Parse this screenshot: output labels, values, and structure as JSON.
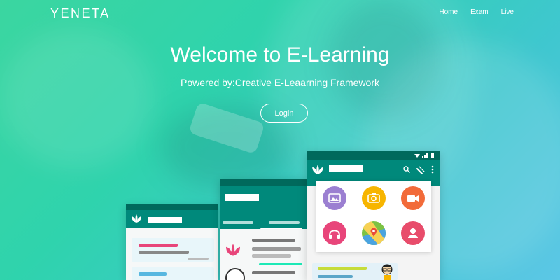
{
  "brand": "YENETA",
  "nav": {
    "home": "Home",
    "exam": "Exam",
    "live": "Live"
  },
  "hero": {
    "title": "Welcome to E-Learning",
    "subtitle": "Powered by:Creative E-Leaarning Framework",
    "login_label": "Login"
  },
  "icons": {
    "lotus": "lotus-icon",
    "search": "search-icon",
    "attach": "paperclip-icon",
    "more": "more-vert-icon",
    "gallery": "gallery-icon",
    "camera": "camera-icon",
    "video": "video-icon",
    "headphones": "headphones-icon",
    "map": "map-icon",
    "contact": "contact-icon"
  },
  "colors": {
    "gradient_start": "#3bd6a0",
    "gradient_end": "#5cc7e6",
    "appbar": "#00897b",
    "statusbar": "#00695c",
    "gallery": "#9b7fd1",
    "camera": "#f7b500",
    "video": "#f26b3a",
    "headphones": "#e8457a",
    "map": "#7cc243",
    "contact": "#e84c6b"
  }
}
